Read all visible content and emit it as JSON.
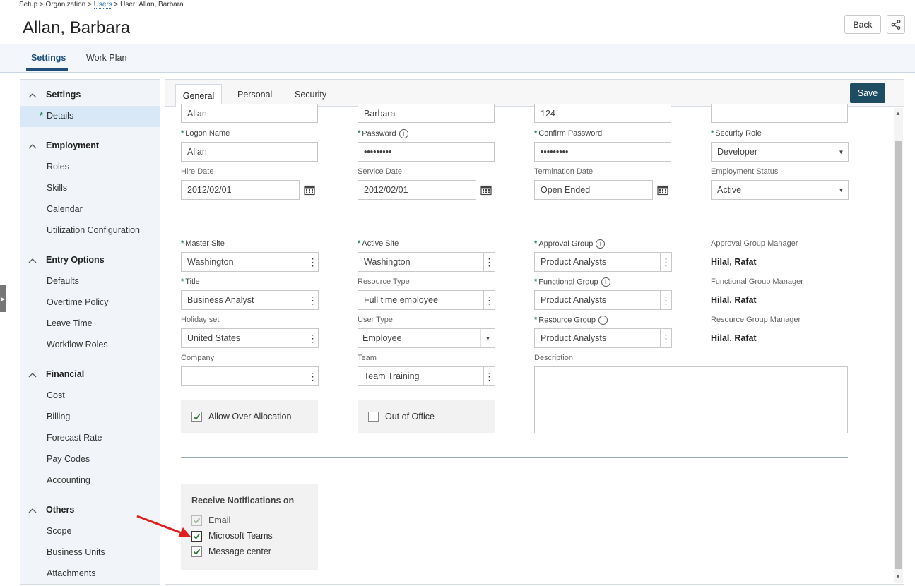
{
  "breadcrumb": {
    "part1": "Setup > Organization > ",
    "link": "Users",
    "part2": " > User: Allan, Barbara"
  },
  "page_title": "Allan, Barbara",
  "header_buttons": {
    "back": "Back",
    "share_icon": "share-icon"
  },
  "top_tabs": [
    {
      "label": "Settings",
      "active": true
    },
    {
      "label": "Work Plan",
      "active": false
    }
  ],
  "sidebar": {
    "sections": [
      {
        "label": "Settings",
        "items": [
          "Details"
        ]
      },
      {
        "label": "Employment",
        "items": [
          "Roles",
          "Skills",
          "Calendar",
          "Utilization Configuration"
        ]
      },
      {
        "label": "Entry Options",
        "items": [
          "Defaults",
          "Overtime Policy",
          "Leave Time",
          "Workflow Roles"
        ]
      },
      {
        "label": "Financial",
        "items": [
          "Cost",
          "Billing",
          "Forecast Rate",
          "Pay Codes",
          "Accounting"
        ]
      },
      {
        "label": "Others",
        "items": [
          "Scope",
          "Business Units",
          "Attachments"
        ]
      }
    ],
    "selected": "Details",
    "selected_marker": "*"
  },
  "form_tabs": [
    {
      "label": "General",
      "active": true
    },
    {
      "label": "Personal",
      "active": false
    },
    {
      "label": "Security",
      "active": false
    }
  ],
  "save_label": "Save",
  "form": {
    "row0": {
      "first": "Allan",
      "last": "Barbara",
      "id": "124",
      "fourth": ""
    },
    "logon_name": {
      "label": "Logon Name",
      "value": "Allan"
    },
    "password": {
      "label": "Password",
      "value": "•••••••••"
    },
    "confirm_password": {
      "label": "Confirm Password",
      "value": "•••••••••"
    },
    "security_role": {
      "label": "Security Role",
      "value": "Developer"
    },
    "hire_date": {
      "label": "Hire Date",
      "value": "2012/02/01"
    },
    "service_date": {
      "label": "Service Date",
      "value": "2012/02/01"
    },
    "termination_date": {
      "label": "Termination Date",
      "value": "Open Ended"
    },
    "employment_status": {
      "label": "Employment Status",
      "value": "Active"
    },
    "master_site": {
      "label": "Master Site",
      "value": "Washington"
    },
    "active_site": {
      "label": "Active Site",
      "value": "Washington"
    },
    "approval_group": {
      "label": "Approval Group",
      "value": "Product Analysts"
    },
    "approval_group_manager": {
      "label": "Approval Group Manager",
      "value": "Hilal, Rafat"
    },
    "title": {
      "label": "Title",
      "value": "Business Analyst"
    },
    "resource_type": {
      "label": "Resource Type",
      "value": "Full time employee"
    },
    "functional_group": {
      "label": "Functional Group",
      "value": "Product Analysts"
    },
    "functional_group_manager": {
      "label": "Functional Group Manager",
      "value": "Hilal, Rafat"
    },
    "holiday_set": {
      "label": "Holiday set",
      "value": "United States"
    },
    "user_type": {
      "label": "User Type",
      "value": "Employee"
    },
    "resource_group": {
      "label": "Resource Group",
      "value": "Product Analysts"
    },
    "resource_group_manager": {
      "label": "Resource Group Manager",
      "value": "Hilal, Rafat"
    },
    "company": {
      "label": "Company",
      "value": ""
    },
    "team": {
      "label": "Team",
      "value": "Team Training"
    },
    "description": {
      "label": "Description",
      "value": ""
    },
    "allow_over_allocation": {
      "label": "Allow Over Allocation",
      "checked": true
    },
    "out_of_office": {
      "label": "Out of Office",
      "checked": false
    }
  },
  "notifications": {
    "title": "Receive Notifications on",
    "options": [
      {
        "label": "Email",
        "checked": true,
        "disabled": true
      },
      {
        "label": "Microsoft Teams",
        "checked": true,
        "disabled": false
      },
      {
        "label": "Message center",
        "checked": true,
        "disabled": false
      }
    ]
  },
  "colors": {
    "accent": "#1d4f7a",
    "save_bg": "#1e4d63",
    "required_star": "#2e8b57",
    "annotation_arrow": "#e02020"
  }
}
